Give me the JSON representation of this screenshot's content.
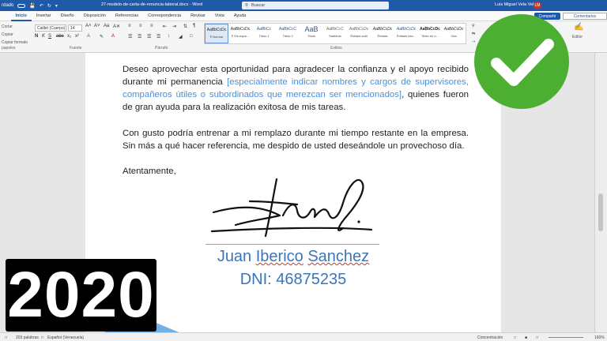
{
  "titlebar": {
    "autosave": "rdado",
    "doc_title": "27-modelo-de-carta-de-renuncia-laboral.docx  -  Word",
    "search_placeholder": "Buscar",
    "user_name": "Luis Miguel Vela Vela",
    "user_initials": "LM"
  },
  "tabs": [
    "Inicio",
    "Insertar",
    "Diseño",
    "Disposición",
    "Referencias",
    "Correspondencia",
    "Revisar",
    "Vista",
    "Ayuda"
  ],
  "tab_active": "Inicio",
  "share_label": "Compartir",
  "comments_label": "Comentarios",
  "ribbon": {
    "clipboard": {
      "cut": "Cortar",
      "copy": "Copiar",
      "format": "Copiar formato",
      "group": "papeles"
    },
    "font": {
      "name": "Calibri (Cuerpo)",
      "size": "14",
      "group": "Fuente"
    },
    "paragraph": {
      "group": "Párrafo"
    },
    "styles": {
      "group": "Estilos",
      "items": [
        {
          "preview": "AaBbCcDc",
          "name": "¶ Normal"
        },
        {
          "preview": "AaBbCcDc",
          "name": "¶ Sin espa..."
        },
        {
          "preview": "AaBbCc",
          "name": "Título 1"
        },
        {
          "preview": "AaBbCcC",
          "name": "Título 2"
        },
        {
          "preview": "AaB",
          "name": "Título"
        },
        {
          "preview": "AaBbCcC",
          "name": "Subtítulo"
        },
        {
          "preview": "AaBbCcDc",
          "name": "Énfasis sutil"
        },
        {
          "preview": "AaBbCcDc",
          "name": "Énfasis"
        },
        {
          "preview": "AaBbCcDc",
          "name": "Énfasis inte..."
        },
        {
          "preview": "AaBbCcDc",
          "name": "Texto en n..."
        },
        {
          "preview": "AaBbCcDc",
          "name": "Cita"
        }
      ]
    },
    "editor": {
      "label": "Editor"
    },
    "dictate_label": "Dictar",
    "voz_label": "Voz"
  },
  "document": {
    "para1_a": "Deseo aprovechar esta oportunidad para agradecer la confianza y el apoyo recibido durante mi permanencia ",
    "para1_note": "[especialmente indicar nombres y cargos de supervisores, compañeros útiles o subordinados que merezcan ser mencionados]",
    "para1_b": ", quienes fueron de gran ayuda para la realización exitosa de mis tareas.",
    "para2": "Con gusto podría entrenar a mi remplazo durante mi tiempo restante en la empresa. Sin más a qué hacer referencia, me despido de usted deseándole un provechoso día.",
    "closing": "Atentamente,",
    "signer_first": "Juan ",
    "signer_middle": "Iberico",
    "signer_space": " ",
    "signer_last": "Sanchez",
    "dni": "DNI: 46875235"
  },
  "statusbar": {
    "words": "203 palabras",
    "language": "Español (Venezuela)",
    "focus": "Concentración",
    "zoom": "160%"
  },
  "overlay": {
    "year": "2020",
    "check_color": "#4caf32"
  }
}
